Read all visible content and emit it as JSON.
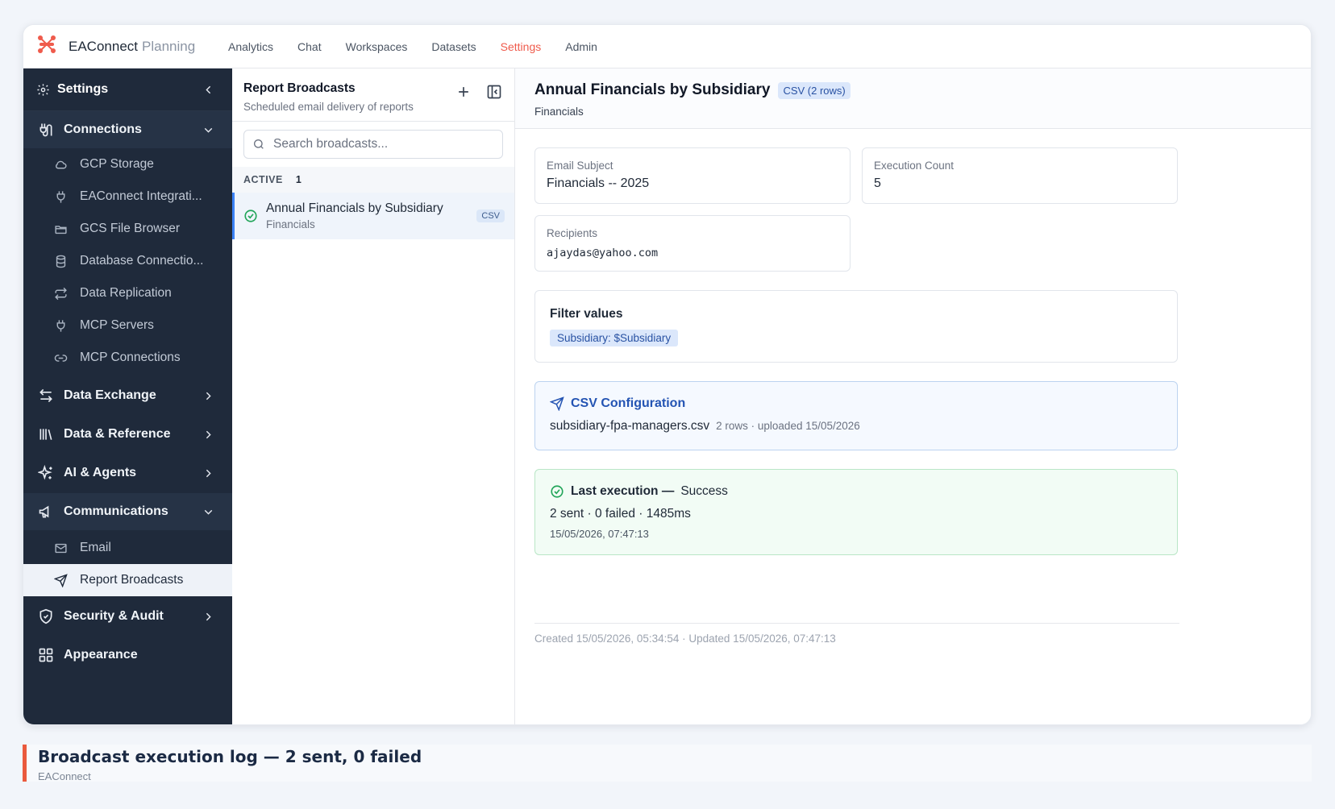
{
  "app": {
    "name": "EAConnect",
    "module": "Planning"
  },
  "nav": [
    "Analytics",
    "Chat",
    "Workspaces",
    "Datasets",
    "Settings",
    "Admin"
  ],
  "nav_active": "Settings",
  "sidebar": {
    "title": "Settings",
    "groups": {
      "connections": "Connections",
      "data_exchange": "Data Exchange",
      "data_reference": "Data & Reference",
      "ai_agents": "AI & Agents",
      "communications": "Communications",
      "security": "Security & Audit",
      "appearance": "Appearance"
    },
    "connections_items": [
      "GCP Storage",
      "EAConnect Integrati...",
      "GCS File Browser",
      "Database Connectio...",
      "Data Replication",
      "MCP Servers",
      "MCP Connections"
    ],
    "communications_items": [
      "Email",
      "Report Broadcasts"
    ]
  },
  "list": {
    "title": "Report Broadcasts",
    "subtitle": "Scheduled email delivery of reports",
    "search_placeholder": "Search broadcasts...",
    "section_label": "ACTIVE",
    "section_count": "1",
    "items": [
      {
        "name": "Annual Financials by Subsidiary",
        "category": "Financials",
        "badge": "CSV"
      }
    ]
  },
  "detail": {
    "title": "Annual Financials by Subsidiary",
    "badge": "CSV (2 rows)",
    "category": "Financials",
    "email_subject_label": "Email Subject",
    "email_subject": "Financials -- 2025",
    "execution_count_label": "Execution Count",
    "execution_count": "5",
    "recipients_label": "Recipients",
    "recipients": "ajaydas@yahoo.com",
    "filter_title": "Filter values",
    "filter_chip": "Subsidiary: $Subsidiary",
    "csv_title": "CSV Configuration",
    "csv_file": "subsidiary-fpa-managers.csv",
    "csv_meta": "2 rows · uploaded 15/05/2026",
    "exec_label": "Last execution —",
    "exec_status": "Success",
    "exec_stats": "2 sent · 0 failed · 1485ms",
    "exec_time": "15/05/2026, 07:47:13",
    "footer": "Created 15/05/2026, 05:34:54 · Updated 15/05/2026, 07:47:13"
  },
  "caption": {
    "title": "Broadcast execution log — 2 sent, 0 failed",
    "subtitle": "EAConnect"
  },
  "colors": {
    "accent": "#ef5b4c",
    "sidebar": "#1f2a3b",
    "success": "#22a559",
    "link": "#2454b3"
  }
}
